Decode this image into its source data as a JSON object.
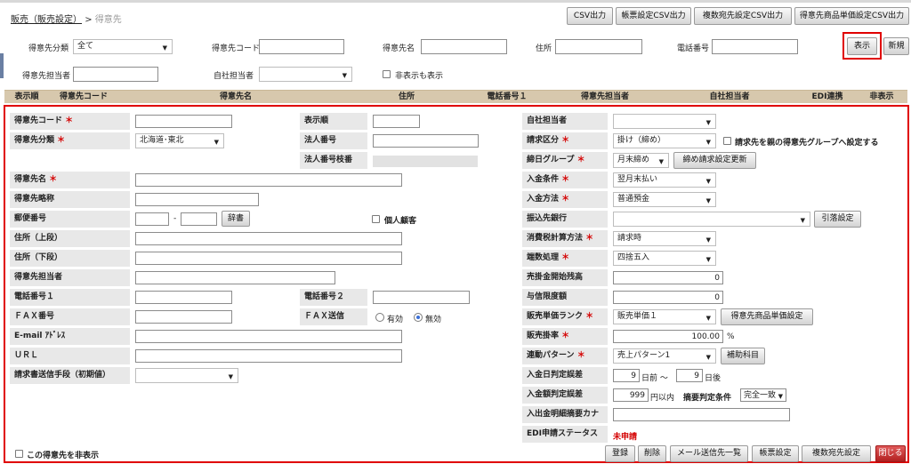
{
  "breadcrumb": {
    "parent": "販売（販売設定）",
    "sep": ">",
    "current": "得意先"
  },
  "toolbar": [
    "CSV出力",
    "帳票設定CSV出力",
    "複数宛先設定CSV出力",
    "得意先商品単価設定CSV出力"
  ],
  "filters": {
    "category_label": "得意先分類",
    "category_value": "全て",
    "code_label": "得意先コード",
    "name_label": "得意先名",
    "address_label": "住所",
    "phone_label": "電話番号",
    "contact_label": "得意先担当者",
    "own_staff_label": "自社担当者",
    "show_hidden_label": "非表示も表示",
    "show_button": "表示",
    "new_button": "新規"
  },
  "table_headers": [
    "表示順",
    "得意先コード",
    "得意先名",
    "住所",
    "電話番号１",
    "得意先担当者",
    "自社担当者",
    "EDI連携",
    "非表示"
  ],
  "form": {
    "code_label": "得意先コード",
    "req_mark": "＊",
    "order_label": "表示順",
    "category_label": "得意先分類",
    "category_value": "北海道･東北",
    "corp_no_label": "法人番号",
    "corp_branch_label": "法人番号枝番",
    "name_label": "得意先名",
    "short_name_label": "得意先略称",
    "zip_label": "郵便番号",
    "zip_dash": "-",
    "dict_button": "辞書",
    "individual_label": "個人顧客",
    "addr1_label": "住所（上段）",
    "addr2_label": "住所（下段）",
    "contact_label": "得意先担当者",
    "phone1_label": "電話番号１",
    "phone2_label": "電話番号２",
    "fax_label": "ＦＡＸ番号",
    "fax_send_label": "ＦＡＸ送信",
    "fax_on": "有効",
    "fax_off": "無効",
    "email_label": "E-mail ｱﾄﾞﾚｽ",
    "url_label": "ＵＲＬ",
    "invoice_method_label": "請求書送信手段（初期値）",
    "own_staff_label": "自社担当者",
    "billing_type_label": "請求区分",
    "billing_type_value": "掛け（締め）",
    "parent_group_label": "請求先を親の得意先グループへ設定する",
    "closing_group_label": "締日グループ",
    "closing_group_value": "月末締め",
    "closing_update_button": "締め請求設定更新",
    "payment_cond_label": "入金条件",
    "payment_cond_value": "翌月末払い",
    "payment_method_label": "入金方法",
    "payment_method_value": "普通預金",
    "bank_label": "振込先銀行",
    "pull_setting_button": "引落設定",
    "tax_calc_label": "消費税計算方法",
    "tax_calc_value": "請求時",
    "rounding_label": "端数処理",
    "rounding_value": "四捨五入",
    "ar_opening_label": "売掛金開始残高",
    "ar_opening_value": "0",
    "credit_limit_label": "与信限度額",
    "credit_limit_value": "0",
    "price_rank_label": "販売単価ランク",
    "price_rank_value": "販売単価１",
    "price_setting_button": "得意先商品単価設定",
    "sales_rate_label": "販売掛率",
    "sales_rate_value": "100.00",
    "percent": "%",
    "pattern_label": "連動パターン",
    "pattern_value": "売上パターン1",
    "aux_button": "補助科目",
    "date_tol_label": "入金日判定誤差",
    "date_before": "9",
    "date_before_unit": "日前 ～",
    "date_after": "9",
    "date_after_unit": "日後",
    "amount_tol_label": "入金額判定誤差",
    "amount_value": "999",
    "amount_unit": "円以内",
    "summary_cond_label": "摘要判定条件",
    "summary_cond_value": "完全一致",
    "kana_label": "入出金明細摘要カナ",
    "edi_label": "EDI申請ステータス",
    "edi_value": "未申請",
    "hide_label": "この得意先を非表示"
  },
  "bottom_buttons": [
    "登録",
    "削除",
    "メール送信先一覧",
    "帳票設定",
    "複数宛先設定",
    "閉じる"
  ],
  "colors": {
    "header_bg": "#d7c8ad",
    "highlight": "#e00000",
    "required": "#d40000"
  }
}
